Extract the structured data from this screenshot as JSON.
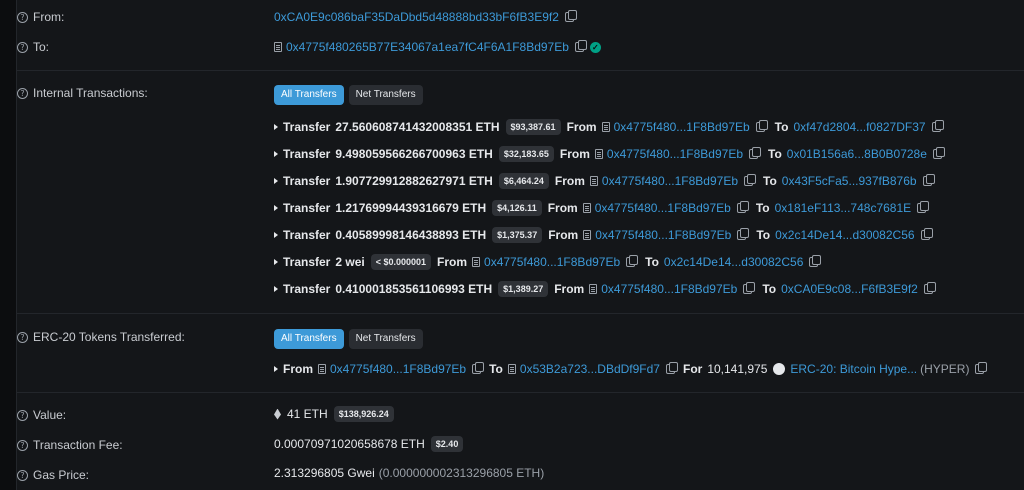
{
  "from": {
    "label": "From:",
    "address": "0xCA0E9c086baF35DaDbd5d48888bd33bF6fB3E9f2"
  },
  "to": {
    "label": "To:",
    "address": "0x4775f480265B77E34067a1ea7fC4F6A1F8Bd97Eb"
  },
  "internal": {
    "label": "Internal Transactions:",
    "tabs": [
      "All Transfers",
      "Net Transfers"
    ],
    "rows": [
      {
        "prefix": "Transfer",
        "amount": "27.560608741432008351 ETH",
        "usd": "$93,387.61",
        "from_label": "From",
        "from_addr": "0x4775f480...1F8Bd97Eb",
        "to_label": "To",
        "to_addr": "0xf47d2804...f0827DF37"
      },
      {
        "prefix": "Transfer",
        "amount": "9.498059566266700963 ETH",
        "usd": "$32,183.65",
        "from_label": "From",
        "from_addr": "0x4775f480...1F8Bd97Eb",
        "to_label": "To",
        "to_addr": "0x01B156a6...8B0B0728e"
      },
      {
        "prefix": "Transfer",
        "amount": "1.907729912882627971 ETH",
        "usd": "$6,464.24",
        "from_label": "From",
        "from_addr": "0x4775f480...1F8Bd97Eb",
        "to_label": "To",
        "to_addr": "0x43F5cFa5...937fB876b"
      },
      {
        "prefix": "Transfer",
        "amount": "1.21769994439316679 ETH",
        "usd": "$4,126.11",
        "from_label": "From",
        "from_addr": "0x4775f480...1F8Bd97Eb",
        "to_label": "To",
        "to_addr": "0x181eF113...748c7681E"
      },
      {
        "prefix": "Transfer",
        "amount": "0.40589998146438893 ETH",
        "usd": "$1,375.37",
        "from_label": "From",
        "from_addr": "0x4775f480...1F8Bd97Eb",
        "to_label": "To",
        "to_addr": "0x2c14De14...d30082C56"
      },
      {
        "prefix": "Transfer",
        "amount": "2 wei",
        "usd": "< $0.000001",
        "from_label": "From",
        "from_addr": "0x4775f480...1F8Bd97Eb",
        "to_label": "To",
        "to_addr": "0x2c14De14...d30082C56"
      },
      {
        "prefix": "Transfer",
        "amount": "0.410001853561106993 ETH",
        "usd": "$1,389.27",
        "from_label": "From",
        "from_addr": "0x4775f480...1F8Bd97Eb",
        "to_label": "To",
        "to_addr": "0xCA0E9c08...F6fB3E9f2"
      }
    ]
  },
  "erc20": {
    "label": "ERC-20 Tokens Transferred:",
    "tabs": [
      "All Transfers",
      "Net Transfers"
    ],
    "row": {
      "from_label": "From",
      "from_addr": "0x4775f480...1F8Bd97Eb",
      "to_label": "To",
      "to_addr": "0x53B2a723...DBdDf9Fd7",
      "for_label": "For",
      "amount": "10,141,975",
      "token": "ERC-20: Bitcoin Hype...",
      "symbol": "(HYPER)"
    }
  },
  "value": {
    "label": "Value:",
    "amount": "41 ETH",
    "usd": "$138,926.24"
  },
  "fee": {
    "label": "Transaction Fee:",
    "amount": "0.00070971020658678 ETH",
    "usd": "$2.40"
  },
  "gas": {
    "label": "Gas Price:",
    "gwei": "2.313296805 Gwei",
    "eth": "(0.000000002313296805 ETH)"
  },
  "icons": {
    "help": "?",
    "check": "✓"
  },
  "colors": {
    "link": "#3d9ad8",
    "accent": "#3d9ad8",
    "success": "#00a186"
  }
}
